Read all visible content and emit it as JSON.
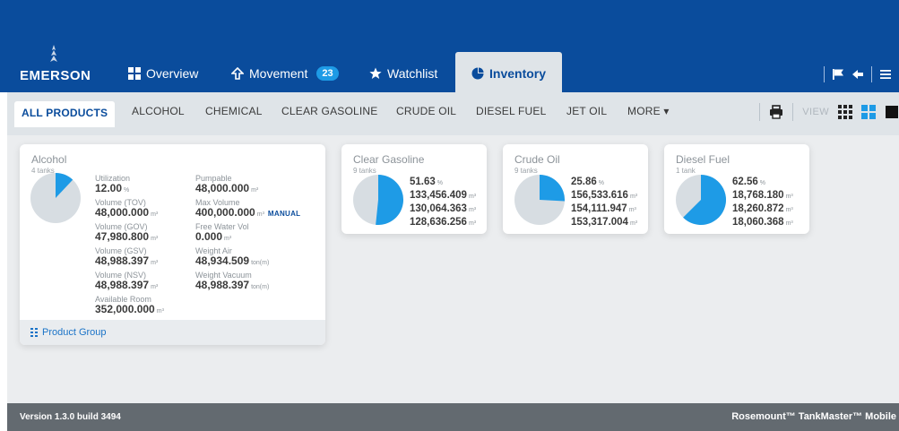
{
  "app": {
    "logo_text": "EMERSON",
    "nav": [
      {
        "label": "Overview",
        "icon": "grid-icon"
      },
      {
        "label": "Movement",
        "icon": "arrow-up-icon",
        "badge": "23"
      },
      {
        "label": "Watchlist",
        "icon": "star-icon"
      },
      {
        "label": "Inventory",
        "icon": "pie-chart-icon",
        "active": true
      }
    ],
    "top_icons": [
      "flag-icon",
      "logout-icon",
      "hamburger-menu-icon"
    ]
  },
  "subnav": {
    "tabs": [
      "ALL PRODUCTS",
      "ALCOHOL",
      "CHEMICAL",
      "CLEAR GASOLINE",
      "CRUDE OIL",
      "DIESEL FUEL",
      "JET OIL",
      "MORE ▾"
    ],
    "active_index": 0,
    "view_label": "VIEW",
    "tool_icons": [
      "print-icon",
      "grid-small-icon",
      "grid-large-icon",
      "square-icon"
    ]
  },
  "alcohol": {
    "title": "Alcohol",
    "subtitle": "4 tanks",
    "pie_fraction": 0.12,
    "left_col": [
      {
        "label": "Utilization",
        "value": "12.00",
        "unit": "%"
      },
      {
        "label": "Volume (TOV)",
        "value": "48,000.000",
        "unit": "m³"
      },
      {
        "label": "Volume (GOV)",
        "value": "47,980.800",
        "unit": "m³"
      },
      {
        "label": "Volume (GSV)",
        "value": "48,988.397",
        "unit": "m³"
      },
      {
        "label": "Volume (NSV)",
        "value": "48,988.397",
        "unit": "m³"
      },
      {
        "label": "Available Room",
        "value": "352,000.000",
        "unit": "m³"
      }
    ],
    "right_col": [
      {
        "label": "Pumpable",
        "value": "48,000.000",
        "unit": "m³"
      },
      {
        "label": "Max Volume",
        "value": "400,000.000",
        "unit": "m³",
        "tag": "MANUAL"
      },
      {
        "label": "Free Water Vol",
        "value": "0.000",
        "unit": "m³"
      },
      {
        "label": "Weight Air",
        "value": "48,934.509",
        "unit": "ton(m)"
      },
      {
        "label": "Weight Vacuum",
        "value": "48,988.397",
        "unit": "ton(m)"
      }
    ],
    "footer_link": "Product Group"
  },
  "small_cards": [
    {
      "title": "Clear Gasoline",
      "subtitle": "9 tanks",
      "pie_fraction": 0.5163,
      "values": [
        {
          "value": "51.63",
          "unit": "%"
        },
        {
          "value": "133,456.409",
          "unit": "m³"
        },
        {
          "value": "130,064.363",
          "unit": "m³"
        },
        {
          "value": "128,636.256",
          "unit": "m³"
        }
      ]
    },
    {
      "title": "Crude Oil",
      "subtitle": "9 tanks",
      "pie_fraction": 0.2586,
      "values": [
        {
          "value": "25.86",
          "unit": "%"
        },
        {
          "value": "156,533.616",
          "unit": "m³"
        },
        {
          "value": "154,111.947",
          "unit": "m³"
        },
        {
          "value": "153,317.004",
          "unit": "m³"
        }
      ]
    },
    {
      "title": "Diesel Fuel",
      "subtitle": "1 tank",
      "pie_fraction": 0.6256,
      "values": [
        {
          "value": "62.56",
          "unit": "%"
        },
        {
          "value": "18,768.180",
          "unit": "m³"
        },
        {
          "value": "18,260.872",
          "unit": "m³"
        },
        {
          "value": "18,060.368",
          "unit": "m³"
        }
      ]
    }
  ],
  "colors": {
    "brand_blue": "#0a4c9c",
    "pie_fill": "#1e9be6",
    "pie_bg": "#d7dde2"
  },
  "status": {
    "version": "Version 1.3.0 build 3494",
    "brand": "Rosemount™ TankMaster™ Mobile"
  }
}
